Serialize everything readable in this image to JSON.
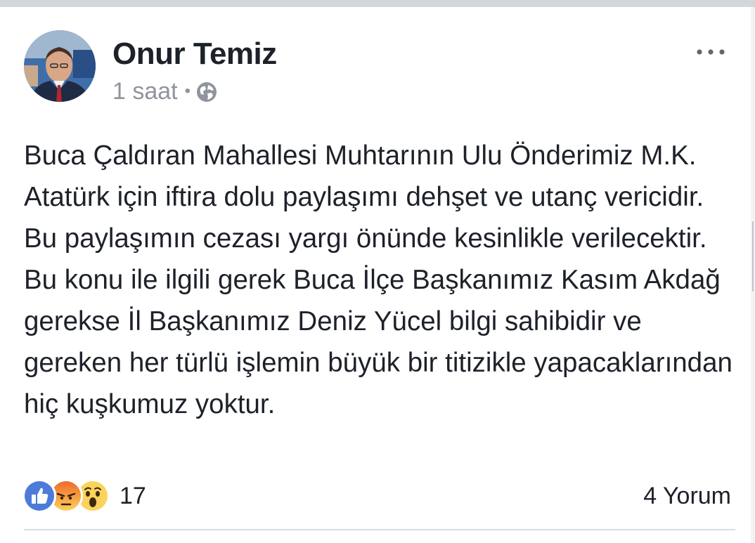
{
  "post": {
    "author": {
      "name": "Onur Temiz"
    },
    "time": "1 saat",
    "separator": "•",
    "privacy_icon": "globe-icon",
    "more_icon": "more-horizontal-icon",
    "text_paragraphs": [
      "Buca Çaldıran Mahallesi Muhtarının Ulu Önderimiz M.K. Atatürk için iftira dolu paylaşımı dehşet ve utanç vericidir. Bu paylaşımın cezası yargı önünde kesinlikle verilecektir.",
      "Bu konu ile ilgili gerek Buca İlçe Başkanımız Kasım Akdağ gerekse İl Başkanımız Deniz Yücel bilgi sahibidir ve gereken her türlü işlemin büyük bir titizikle yapacaklarından hiç kuşkumuz yoktur."
    ],
    "reactions": {
      "icons": [
        "like-reaction-icon",
        "angry-reaction-icon",
        "wow-reaction-icon"
      ],
      "count": "17"
    },
    "comments": "4 Yorum"
  },
  "colors": {
    "like_blue": "#4267b2",
    "angry_orange": "#f0692a",
    "wow_yellow": "#fbd25c",
    "text": "#1d2129",
    "meta_gray": "#90949c"
  }
}
